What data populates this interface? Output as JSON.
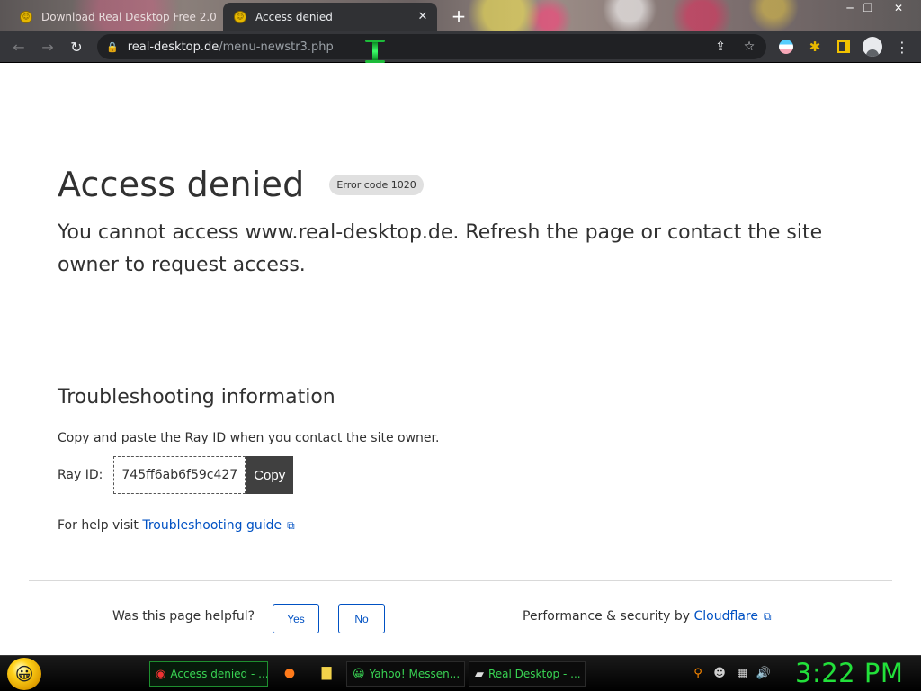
{
  "browser": {
    "tabs": [
      {
        "title": "Download Real Desktop Free 2.0",
        "active": false,
        "favicon": "smiley-favicon-icon"
      },
      {
        "title": "Access denied",
        "active": true,
        "favicon": "smiley-favicon-icon"
      }
    ],
    "close_tab_glyph": "✕",
    "new_tab_glyph": "+",
    "window_controls": {
      "minimize": "─",
      "maximize": "❐",
      "close": "✕"
    },
    "nav": {
      "back": "←",
      "forward": "→",
      "reload": "↻"
    },
    "url": {
      "host": "real-desktop.de",
      "path": "/menu-newstr3.php"
    },
    "omnibox_icons": {
      "share": "⇪",
      "bookmark": "☆"
    },
    "menu_glyph": "⋮",
    "extension_puzzle_glyph": "✱"
  },
  "page": {
    "title": "Access denied",
    "error_code": "Error code 1020",
    "lead": "You cannot access www.real-desktop.de. Refresh the page or contact the site owner to request access.",
    "troubleshooting_heading": "Troubleshooting information",
    "copy_instructions": "Copy and paste the Ray ID when you contact the site owner.",
    "ray_label": "Ray ID:",
    "ray_id": "745ff6ab6f59c427",
    "copy_button": "Copy",
    "help_prefix": "For help visit ",
    "help_link": "Troubleshooting guide",
    "external_link_glyph": "⧉",
    "helpful_question": "Was this page helpful?",
    "yes_button": "Yes",
    "no_button": "No",
    "perf_prefix": "Performance & security by ",
    "perf_link": "Cloudflare"
  },
  "taskbar": {
    "start_glyph": "😀",
    "tasks": [
      {
        "label": "Access denied - ...",
        "icon": "◉",
        "active": true
      },
      {
        "label": "Yahoo! Messen...",
        "icon": "😀",
        "active": false
      },
      {
        "label": "Real Desktop - ...",
        "icon": "▰",
        "active": false
      }
    ],
    "quicklaunch": {
      "firefox": "●",
      "folder": "▇"
    },
    "tray": {
      "search": "⚲",
      "messenger": "☻",
      "network": "▦",
      "volume": "🔊"
    },
    "clock": "3:22 PM"
  },
  "colors": {
    "link": "#0051c3",
    "clock": "#22e03a",
    "task_text": "#39d353",
    "chrome_toolbar": "#35363a",
    "heading_text": "#313131"
  }
}
